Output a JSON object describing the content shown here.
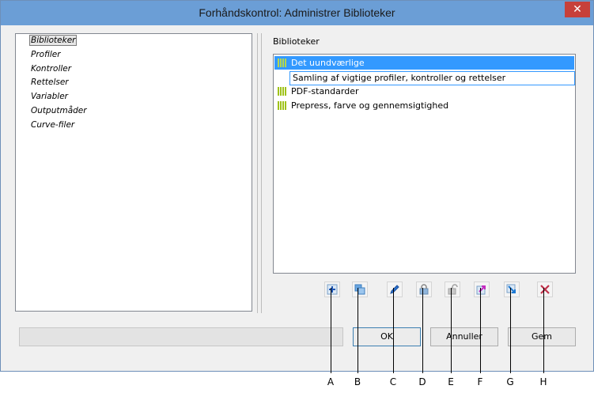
{
  "window": {
    "title": "Forhåndskontrol: Administrer Biblioteker",
    "close_glyph": "✕"
  },
  "tree": {
    "items": [
      {
        "label": "Biblioteker",
        "selected": true
      },
      {
        "label": "Profiler"
      },
      {
        "label": "Kontroller"
      },
      {
        "label": "Rettelser"
      },
      {
        "label": "Variabler"
      },
      {
        "label": "Outputmåder"
      },
      {
        "label": "Curve-filer"
      }
    ]
  },
  "libraries": {
    "heading": "Biblioteker",
    "items": [
      {
        "label": "Det uundværlige",
        "selected": true,
        "icon": "library-icon"
      },
      {
        "label": "PDF-standarder",
        "icon": "library-icon"
      },
      {
        "label": "Prepress, farve og gennemsigtighed",
        "icon": "library-icon"
      }
    ],
    "description": "Samling af vigtige profiler, kontroller og rettelser"
  },
  "toolbar": {
    "buttons": [
      {
        "letter": "A",
        "icon": "add-icon"
      },
      {
        "letter": "B",
        "icon": "duplicate-icon"
      },
      {
        "letter": "C",
        "icon": "edit-icon"
      },
      {
        "letter": "D",
        "icon": "lock-icon"
      },
      {
        "letter": "E",
        "icon": "unlock-icon"
      },
      {
        "letter": "F",
        "icon": "import-icon"
      },
      {
        "letter": "G",
        "icon": "export-icon"
      },
      {
        "letter": "H",
        "icon": "delete-icon"
      }
    ]
  },
  "buttons": {
    "ok": "OK",
    "cancel": "Annuller",
    "save": "Gem"
  },
  "colors": {
    "titlebar": "#6b9ed6",
    "selection": "#3399ff",
    "library_icon": "#9fc21a",
    "delete": "#c0304a"
  }
}
